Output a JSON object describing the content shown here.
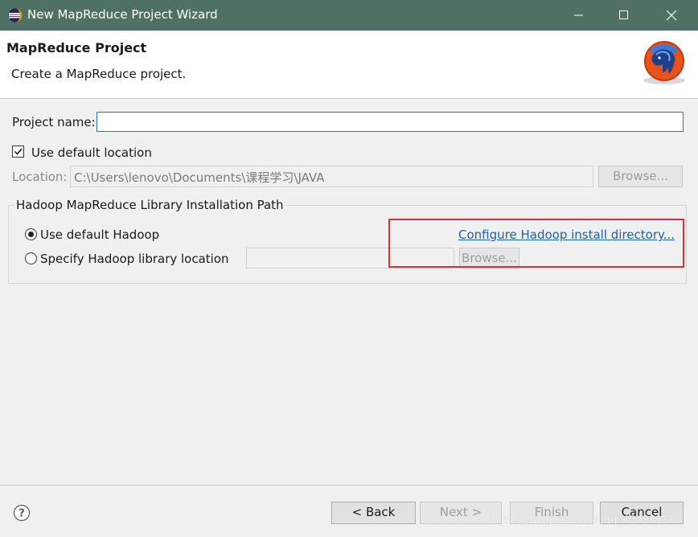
{
  "window": {
    "title": "New MapReduce Project Wizard",
    "title_bar_color": "#4f7164"
  },
  "header": {
    "title": "MapReduce Project",
    "description": "Create a MapReduce project."
  },
  "form": {
    "project_name_label": "Project name:",
    "project_name_value": "",
    "use_default_location_label": "Use default location",
    "use_default_location_checked": true,
    "location_label": "Location:",
    "location_value": "C:\\Users\\lenovo\\Documents\\课程学习\\JAVA",
    "browse_label": "Browse..."
  },
  "hadoop_group": {
    "title": "Hadoop MapReduce Library Installation Path",
    "use_default_label": "Use default Hadoop",
    "use_default_selected": true,
    "specify_label": "Specify Hadoop library location",
    "specify_value": "",
    "configure_link": "Configure Hadoop install directory...",
    "browse_label": "Browse..."
  },
  "buttons": {
    "back": "< Back",
    "next": "Next >",
    "finish": "Finish",
    "cancel": "Cancel"
  },
  "watermark": "https://blog.csdn.net/qq_40434150",
  "icons": [
    "eclipse-app-icon",
    "minimize-icon",
    "maximize-icon",
    "close-icon",
    "mapreduce-elephant-logo",
    "help-icon",
    "checkmark-icon"
  ],
  "accent_colors": {
    "highlight": "#e03030",
    "link": "#1a5fb4",
    "focus": "#1e78c9"
  }
}
